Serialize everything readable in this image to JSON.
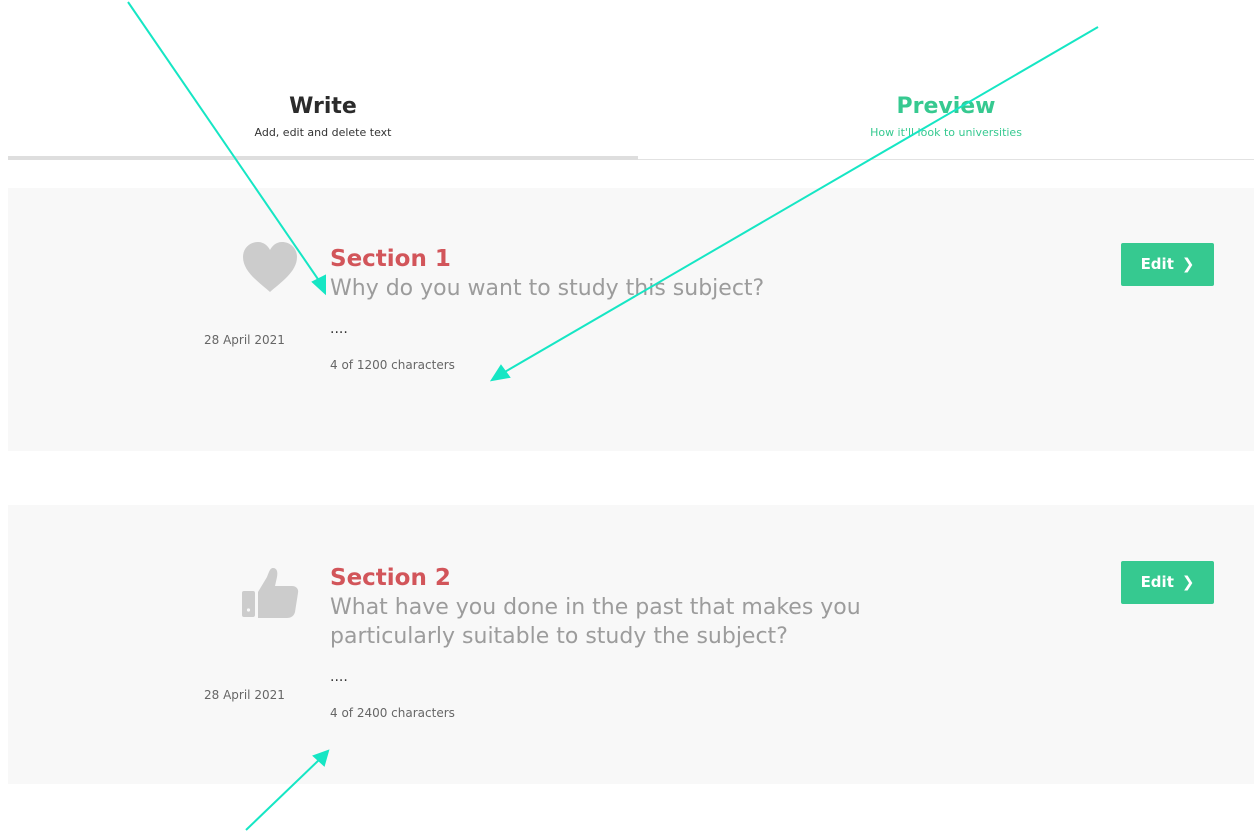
{
  "tabs": {
    "write": {
      "title": "Write",
      "subtitle": "Add, edit and delete text"
    },
    "preview": {
      "title": "Preview",
      "subtitle": "How it'll look to universities"
    }
  },
  "sections": [
    {
      "icon": "heart-icon",
      "title": "Section 1",
      "question": "Why do you want to study this subject?",
      "date": "28 April 2021",
      "text": "....",
      "count": "4 of 1200 characters",
      "edit_label": "Edit"
    },
    {
      "icon": "thumbs-up-icon",
      "title": "Section 2",
      "question": "What have you done in the past that makes you particularly suitable to study the subject?",
      "date": "28 April 2021",
      "text": "....",
      "count": "4 of 2400 characters",
      "edit_label": "Edit"
    }
  ],
  "colors": {
    "accent_green": "#36c990",
    "section_title_red": "#d2555a",
    "card_bg": "#f8f8f8",
    "icon_gray": "#cccccc",
    "annotation_arrow": "#16e6c4"
  }
}
